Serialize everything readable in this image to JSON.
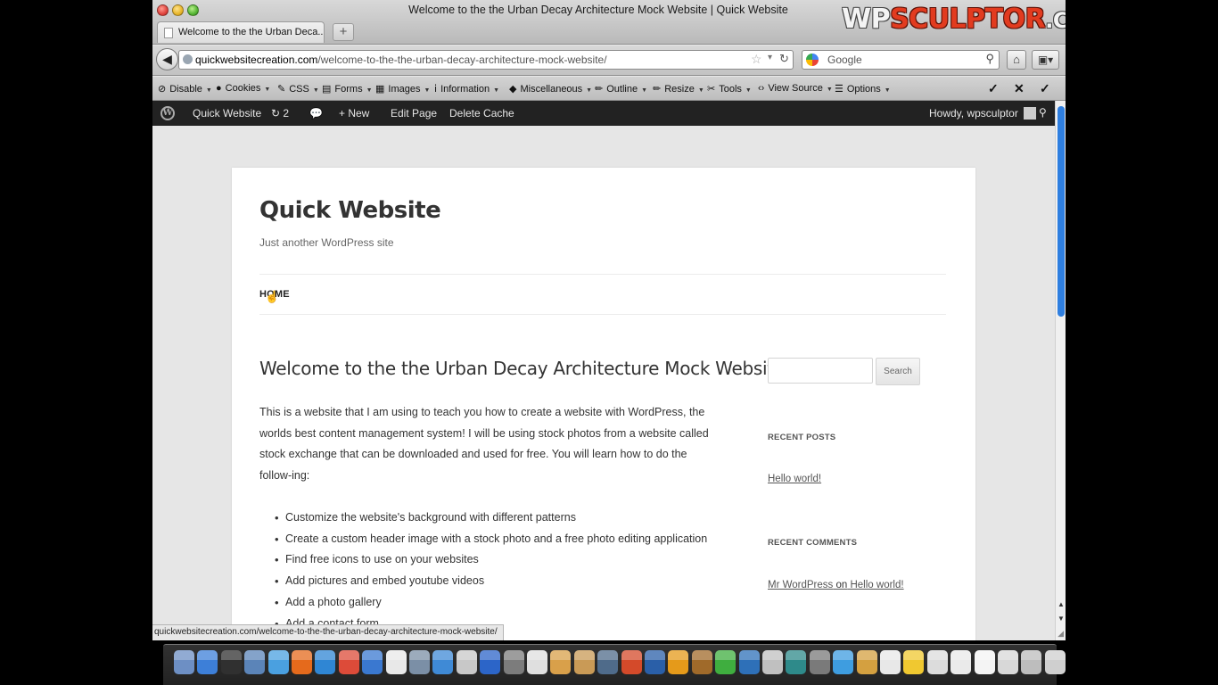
{
  "browser": {
    "window_title": "Welcome to the the Urban Decay Architecture Mock Website | Quick Website",
    "logo": {
      "part1": "WP",
      "part2": "SCULPTOR",
      "part3": ".COM"
    },
    "tab_label": "Welcome to the the Urban Deca...",
    "new_tab_glyph": "+",
    "url_host": "quickwebsitecreation.com",
    "url_path": "/welcome-to-the-the-urban-decay-architecture-mock-website/",
    "search_placeholder": "Google",
    "status_url": "quickwebsitecreation.com/welcome-to-the-the-urban-decay-architecture-mock-website/"
  },
  "devbar": {
    "items": [
      "Disable",
      "Cookies",
      "CSS",
      "Forms",
      "Images",
      "Information",
      "Miscellaneous",
      "Outline",
      "Resize",
      "Tools",
      "View Source",
      "Options"
    ]
  },
  "adminbar": {
    "site_name": "Quick Website",
    "updates_count": "2",
    "new_label": "New",
    "edit_page": "Edit Page",
    "delete_cache": "Delete Cache",
    "howdy": "Howdy, wpsculptor"
  },
  "site": {
    "title": "Quick Website",
    "description": "Just another WordPress site",
    "nav_home": "HOME"
  },
  "post": {
    "title": "Welcome to the the Urban Decay Architecture Mock Website",
    "paragraph": "This is a website that I am using to teach you how to create a website with WordPress, the worlds best content management system!  I will be using stock photos from a website called stock exchange that can be downloaded and used for free.  You will learn how to do the follow-ing:",
    "list": [
      "Customize the website's background with different patterns",
      "Create a custom header image with a stock photo and a free photo editing application",
      "Find free icons to use on your websites",
      "Add pictures and embed youtube videos",
      "Add a photo gallery",
      "Add a contact form"
    ]
  },
  "sidebar": {
    "search_button": "Search",
    "recent_posts_title": "RECENT POSTS",
    "recent_post_link": "Hello world!",
    "recent_comments_title": "RECENT COMMENTS",
    "comment_author": "Mr WordPress",
    "comment_on": "on",
    "comment_post": "Hello world!"
  },
  "dock": {
    "icon_colors": [
      "#6d8fc4",
      "#3d7fd8",
      "#303030",
      "#5b84b8",
      "#4aa0e0",
      "#e56a1c",
      "#2f86d4",
      "#dd4b39",
      "#3a78d0",
      "#e8e8e8",
      "#7b8fa6",
      "#3f8ad6",
      "#c8c8c8",
      "#2c65c8",
      "#7c7c7c",
      "#dfdfdf",
      "#d9a04a",
      "#c99a56",
      "#4f6b8a",
      "#d44a2a",
      "#2a5fa8",
      "#e59a1a",
      "#a06a2a",
      "#3fae3f",
      "#2e70b8",
      "#c0c0c0",
      "#2e8a8a",
      "#7a7a7a",
      "#3e9de0",
      "#d4a040",
      "#e8e8e8",
      "#f0c830",
      "#dcdcdc",
      "#eaeaea",
      "#f4f4f4",
      "#d8d8d8",
      "#bdbdbd",
      "#cfcfcf"
    ]
  }
}
